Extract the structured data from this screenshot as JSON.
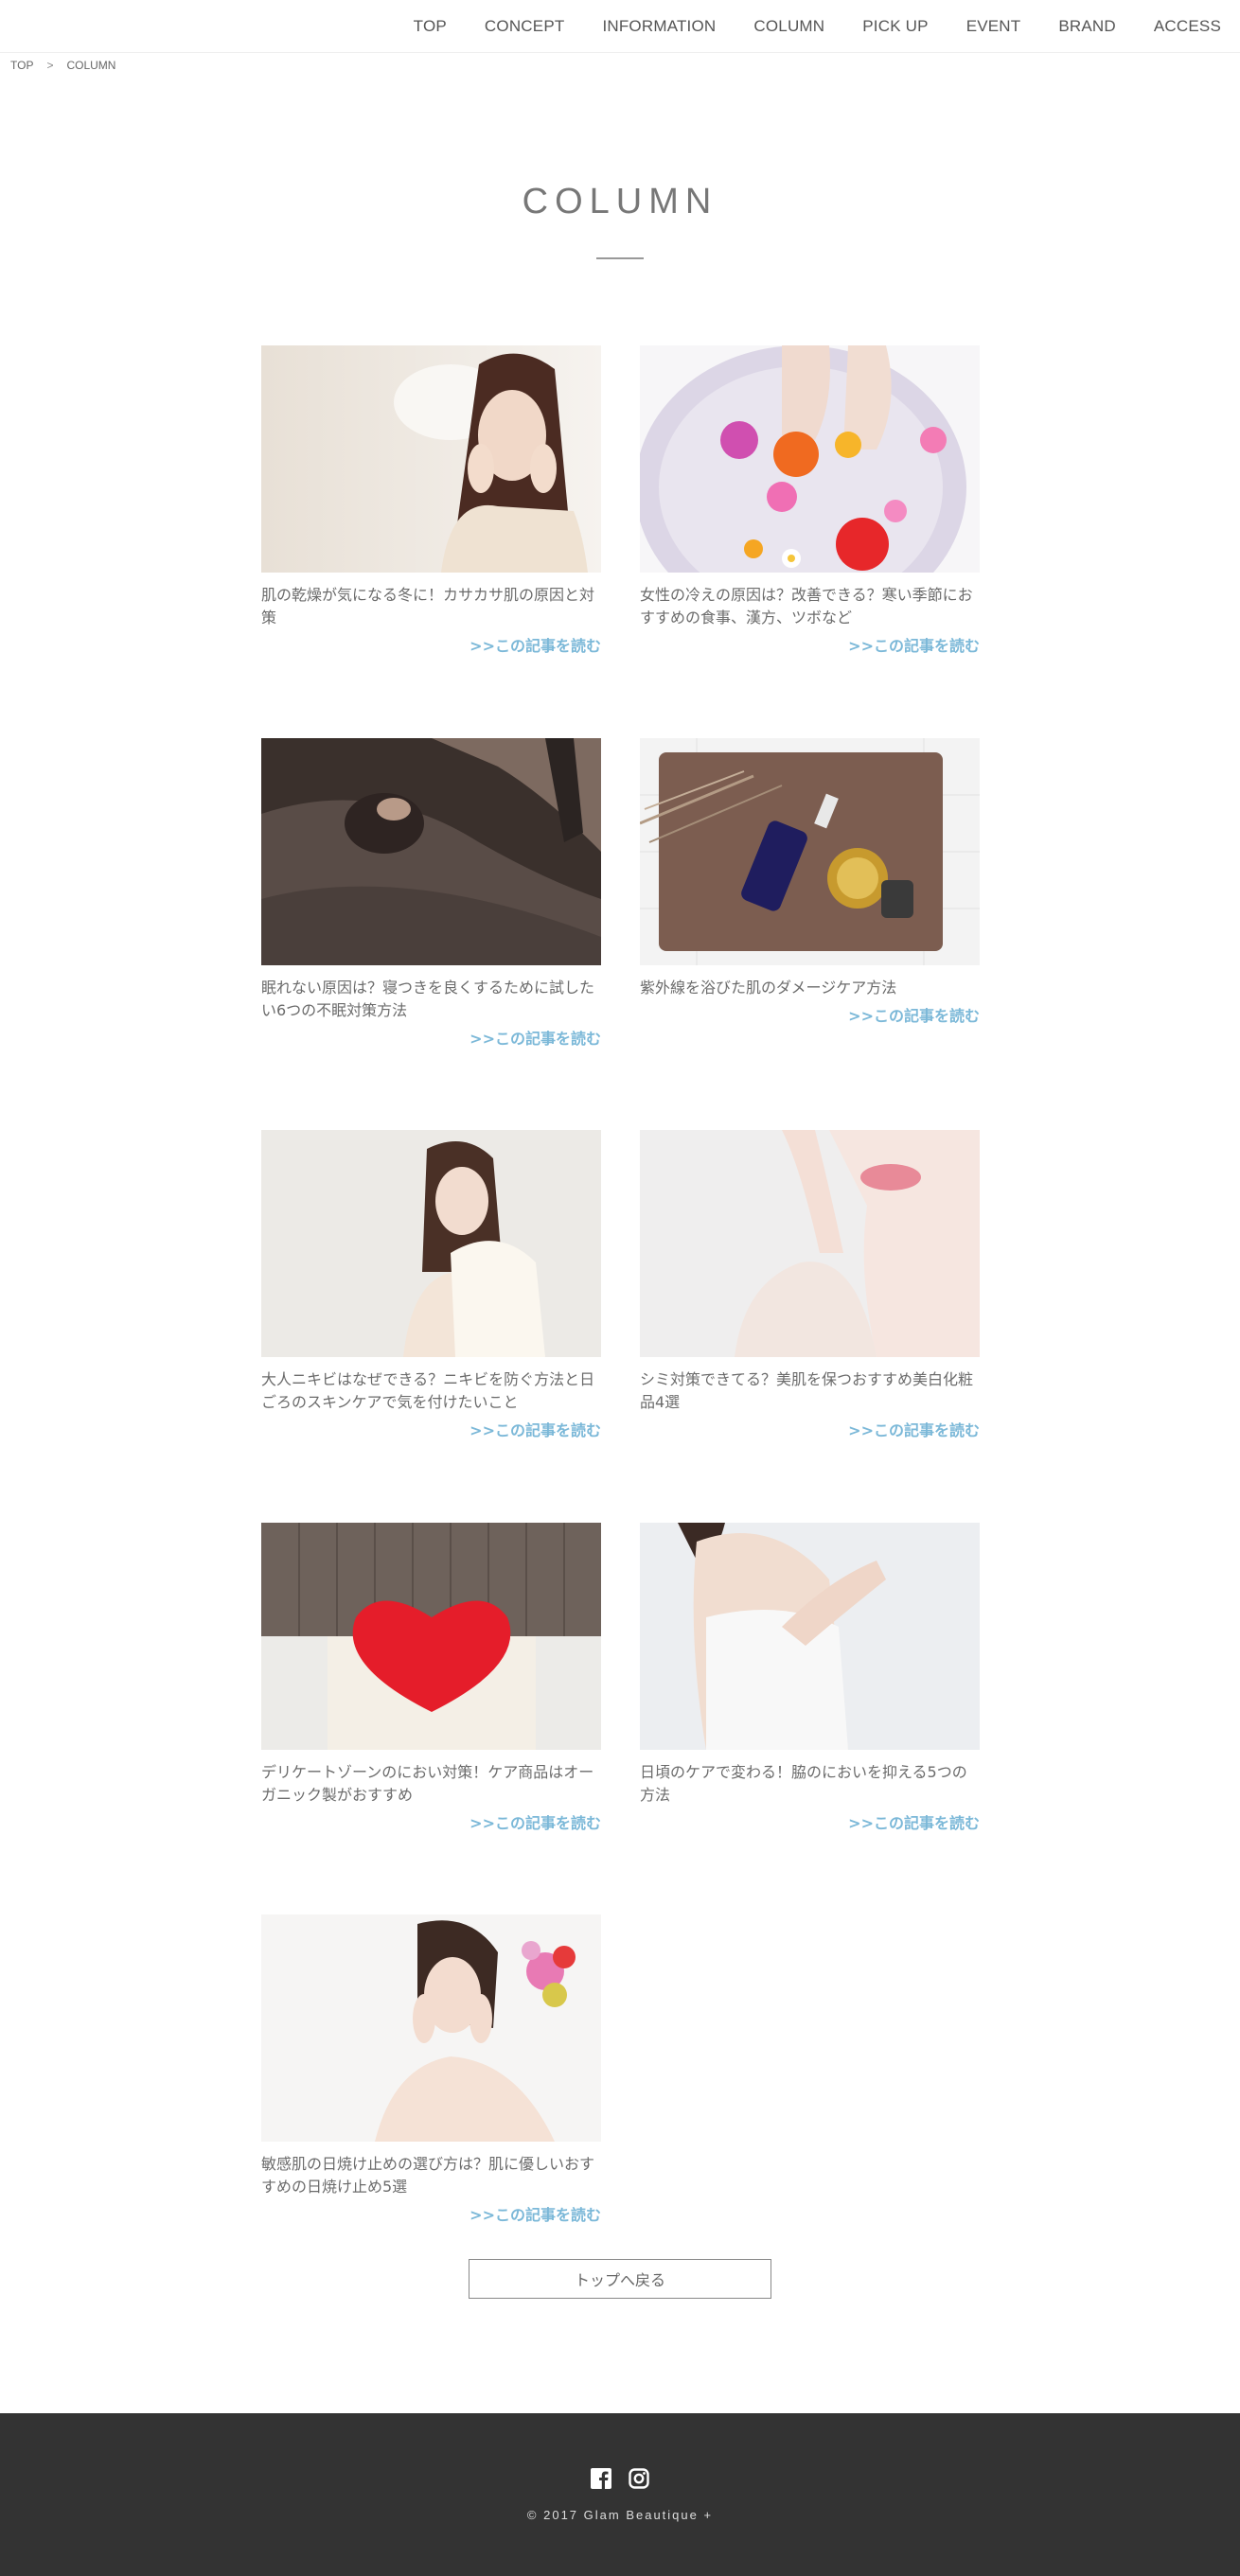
{
  "nav": {
    "items": [
      "TOP",
      "CONCEPT",
      "INFORMATION",
      "COLUMN",
      "PICK UP",
      "EVENT",
      "BRAND",
      "ACCESS"
    ]
  },
  "breadcrumb": {
    "home": "TOP",
    "separator": ">",
    "current": "COLUMN"
  },
  "page": {
    "title": "COLUMN"
  },
  "read_more_label": ">>この記事を読む",
  "articles": [
    {
      "title": "肌の乾燥が気になる冬に！カサカサ肌の原因と対策",
      "image": "woman-touching-face"
    },
    {
      "title": "女性の冷えの原因は？改善できる？寒い季節におすすめの食事、漢方、ツボなど",
      "image": "foot-bath-flowers"
    },
    {
      "title": "眠れない原因は？寝つきを良くするために試したい6つの不眠対策方法",
      "image": "woman-sleeping"
    },
    {
      "title": "紫外線を浴びた肌のダメージケア方法",
      "image": "skincare-bottles-on-towel"
    },
    {
      "title": "大人ニキビはなぜできる？ニキビを防ぐ方法と日ごろのスキンケアで気を付けたいこと",
      "image": "woman-with-towel"
    },
    {
      "title": "シミ対策できてる？美肌を保つおすすめ美白化粧品4選",
      "image": "hand-on-cheek"
    },
    {
      "title": "デリケートゾーンのにおい対策！ケア商品はオーガニック製がおすすめ",
      "image": "red-heart-cushion"
    },
    {
      "title": "日頃のケアで変わる！脇のにおいを抑える5つの方法",
      "image": "woman-in-towel"
    },
    {
      "title": "敏感肌の日焼け止めの選び方は？肌に優しいおすすめの日焼け止め5選",
      "image": "woman-with-flowers-in-hair"
    }
  ],
  "back_button": "トップへ戻る",
  "footer": {
    "copyright": "© 2017 Glam Beautique +",
    "social": [
      "facebook-icon",
      "instagram-icon"
    ]
  },
  "colors": {
    "accent": "#7bb8d8",
    "footer_bg": "#333333",
    "text": "#666666"
  }
}
